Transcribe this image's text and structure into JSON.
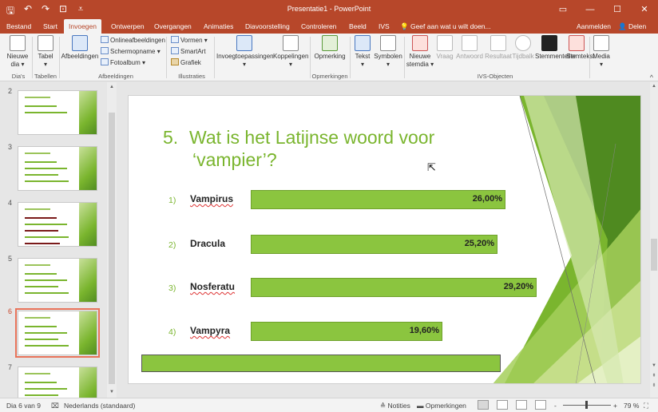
{
  "titlebar": {
    "title": "Presentatie1 - PowerPoint",
    "qat_icons": [
      "save-icon",
      "undo-icon",
      "redo-icon",
      "present-icon",
      "customize-icon"
    ],
    "qat_glyphs": [
      "🖫",
      "↶",
      "↷",
      "⊡",
      "⩡"
    ],
    "window_controls": [
      "▭",
      "—",
      "☐",
      "✕"
    ]
  },
  "tabs": {
    "items": [
      "Bestand",
      "Start",
      "Invoegen",
      "Ontwerpen",
      "Overgangen",
      "Animaties",
      "Diavoorstelling",
      "Controleren",
      "Beeld",
      "IVS"
    ],
    "active": "Invoegen",
    "tell_me": "Geef aan wat u wilt doen...",
    "tell_me_icon": "lightbulb-icon",
    "tell_me_glyph": "💡",
    "signin": "Aanmelden",
    "share": "Delen",
    "share_glyph": "👤"
  },
  "ribbon": {
    "new_slide": "Nieuwe dia",
    "table": "Tabel",
    "images": "Afbeeldingen",
    "online_images": "Onlineafbeeldingen",
    "screenshot": "Schermopname",
    "photo_album": "Fotoalbum",
    "shapes": "Vormen",
    "smartart": "SmartArt",
    "chart": "Grafiek",
    "addins": "Invoegtoepassingen",
    "links": "Koppelingen",
    "comment": "Opmerking",
    "text": "Tekst",
    "symbols": "Symbolen",
    "new_question": "Nieuwe stemdia",
    "question": "Vraag",
    "answer": "Antwoord",
    "result": "Resultaat",
    "timer": "Tijdbalk",
    "vote_counter": "Stemmenteller",
    "vote_text": "Stemtekst",
    "media": "Media",
    "groups": {
      "slides": "Dia's",
      "tables": "Tabellen",
      "images": "Afbeeldingen",
      "illustrations": "Illustraties",
      "comments": "Opmerkingen",
      "ivs": "IVS-Objecten"
    },
    "collapse_glyph": "^"
  },
  "thumbnails": [
    {
      "num": "2",
      "title": "1. Stem in",
      "bars": 2,
      "dark": false
    },
    {
      "num": "3",
      "title": "2. Hoeveel bieden liggen er op de begraafplaats...",
      "bars": 4,
      "dark": false
    },
    {
      "num": "4",
      "title": "3. Van hoe de boogen insecten wegwijzen?",
      "bars": 5,
      "dark": true
    },
    {
      "num": "5",
      "title": "4. Van welke onbekende bekenden...",
      "bars": 4,
      "dark": false
    },
    {
      "num": "6",
      "title": "5. Wat is het Latijnse woord voor 'vampier'?",
      "bars": 4,
      "dark": false,
      "selected": true
    },
    {
      "num": "7",
      "title": "Wie waren met het drumpgeld...",
      "bars": 4,
      "dark": false
    }
  ],
  "slide": {
    "question_number": "5.",
    "question_line1": "Wat is het Latijnse woord voor",
    "question_line2": "‘vampier’?",
    "answers": [
      {
        "idx": "1)",
        "label": "Vampirus",
        "pct": "26,00%",
        "value": 26.0,
        "squiggle": true
      },
      {
        "idx": "2)",
        "label": "Dracula",
        "pct": "25,20%",
        "value": 25.2,
        "squiggle": false
      },
      {
        "idx": "3)",
        "label": "Nosferatu",
        "pct": "29,20%",
        "value": 29.2,
        "squiggle": true
      },
      {
        "idx": "4)",
        "label": "Vampyra",
        "pct": "19,60%",
        "value": 19.6,
        "squiggle": true
      }
    ],
    "colors": {
      "accent": "#7ab52e",
      "bar": "#8bc53f",
      "bar_border": "#6fa12c"
    }
  },
  "statusbar": {
    "slide_info": "Dia 6 van 9",
    "language": "Nederlands (standaard)",
    "notes": "Notities",
    "comments": "Opmerkingen",
    "zoom": "79 %",
    "zoom_minus": "-",
    "zoom_plus": "+",
    "notes_glyph": "≙",
    "comments_glyph": "▬",
    "fit_glyph": "⛶",
    "spell_glyph": "⌧"
  }
}
